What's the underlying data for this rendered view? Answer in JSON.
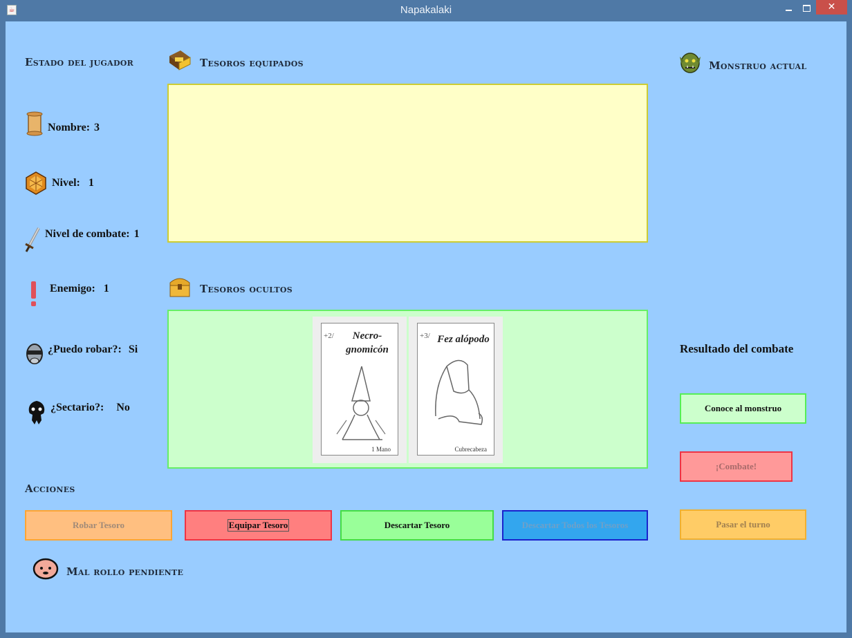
{
  "window": {
    "title": "Napakalaki",
    "close_glyph": "✕"
  },
  "player": {
    "heading": "Estado del jugador",
    "name_label": "Nombre:",
    "name_value": "3",
    "level_label": "Nivel:",
    "level_value": "1",
    "combat_level_label": "Nivel de combate:",
    "combat_level_value": "1",
    "enemy_label": "Enemigo:",
    "enemy_value": "1",
    "can_steal_label": "¿Puedo robar?:",
    "can_steal_value": "Si",
    "cultist_label": "¿Sectario?:",
    "cultist_value": "No"
  },
  "treasures": {
    "equipped_heading": "Tesoros equipados",
    "hidden_heading": "Tesoros ocultos",
    "hidden_cards": [
      {
        "bonus": "+2/",
        "name": "Necro-gnomicón",
        "kind": "1 Mano"
      },
      {
        "bonus": "+3/",
        "name": "Fez alópodo",
        "kind": "Cubrecabeza"
      }
    ]
  },
  "monster": {
    "heading": "Monstruo actual"
  },
  "combat": {
    "result_label": "Resultado del combate",
    "meet_monster": "Conoce al monstruo",
    "fight": "¡Combate!",
    "next_turn": "Pasar el turno"
  },
  "actions": {
    "heading": "Acciones",
    "steal": "Robar Tesoro",
    "equip": "Equipar Tesoro",
    "discard": "Descartar Tesoro",
    "discard_all": "Descartar Todos los Tesoros"
  },
  "bad_luck": {
    "heading": "Mal rollo pendiente"
  },
  "colors": {
    "background": "#99ccff",
    "equipped_panel": "#ffffc8",
    "hidden_panel": "#ccffcc",
    "steal_button": "#ffbf80",
    "equip_button": "#ff7f7f",
    "discard_button": "#99ff99",
    "discard_all_button": "#33a6ee",
    "meet_button": "#ccffcc",
    "fight_button": "#ff9999",
    "next_turn_button": "#ffcc66"
  },
  "icons": [
    "scroll-icon",
    "gem-icon",
    "sword-icon",
    "exclamation-icon",
    "thief-icon",
    "cultist-icon",
    "treasure-chest-gold-icon",
    "treasure-chest-icon",
    "orc-icon",
    "sad-face-icon"
  ]
}
